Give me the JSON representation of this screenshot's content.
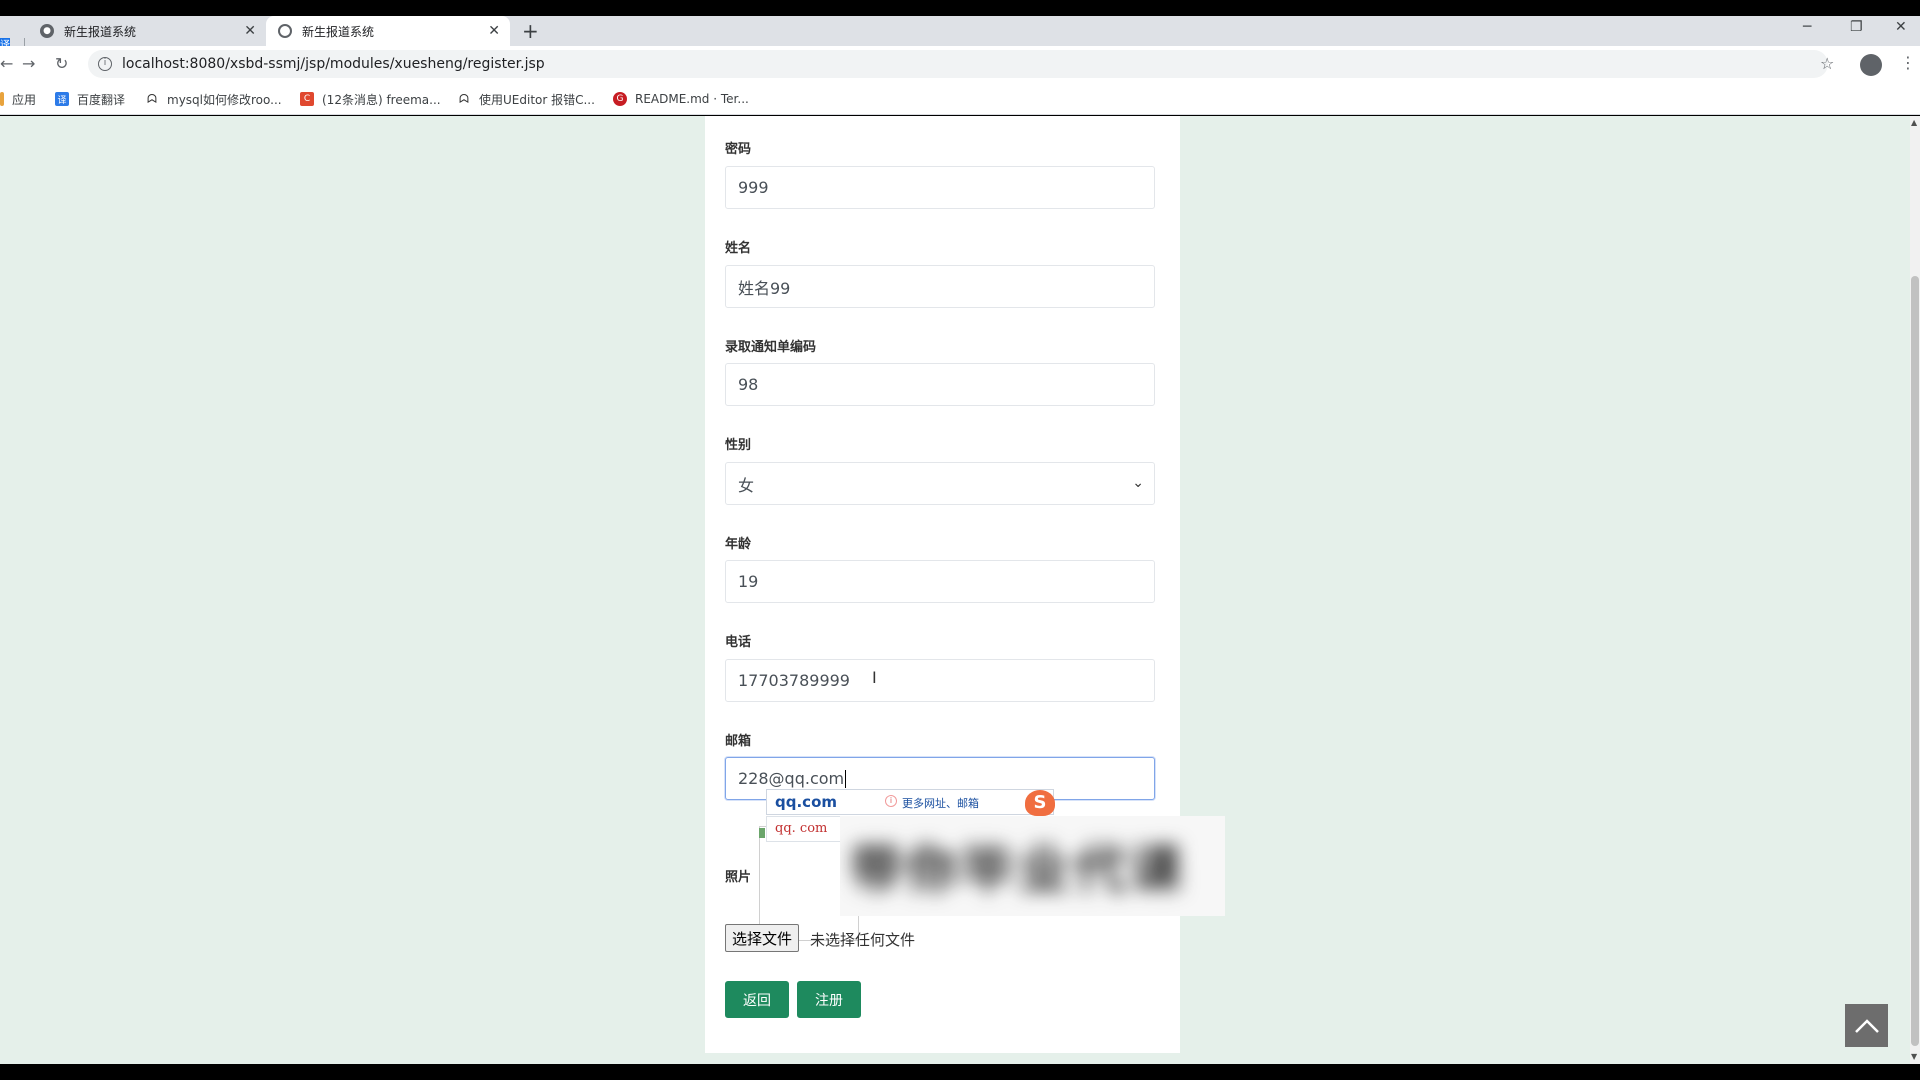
{
  "browser": {
    "tabs": [
      {
        "title": "新生报道系统",
        "active": false
      },
      {
        "title": "新生报道系统",
        "active": true
      }
    ],
    "url": "localhost:8080/xsbd-ssmj/jsp/modules/xuesheng/register.jsp",
    "bookmarks": [
      {
        "label": "应用",
        "icon": "apps-icon"
      },
      {
        "label": "百度翻译",
        "icon": "baidu-translate-icon"
      },
      {
        "label": "mysql如何修改roo...",
        "icon": "link-icon"
      },
      {
        "label": "(12条消息) freema...",
        "icon": "csdn-icon"
      },
      {
        "label": "使用UEditor 报错C...",
        "icon": "link-icon"
      },
      {
        "label": "README.md · Ter...",
        "icon": "gitee-icon"
      }
    ]
  },
  "form": {
    "password": {
      "label": "密码",
      "value": "999"
    },
    "name": {
      "label": "姓名",
      "value": "姓名99"
    },
    "admission_no": {
      "label": "录取通知单编码",
      "value": "98"
    },
    "gender": {
      "label": "性别",
      "value": "女"
    },
    "age": {
      "label": "年龄",
      "value": "19"
    },
    "phone": {
      "label": "电话",
      "value": "17703789999"
    },
    "email": {
      "label": "邮箱",
      "value": "228@qq.com"
    },
    "photo": {
      "label": "照片",
      "file_button": "选择文件",
      "file_status": "未选择任何文件"
    },
    "back_button": "返回",
    "register_button": "注册"
  },
  "ime_popup": {
    "composition": "qq.com",
    "hint": "更多网址、邮箱",
    "candidate": "qq. com",
    "logo": "S"
  },
  "blurred_overlay": {
    "text": "带你毕业代课"
  },
  "colors": {
    "page_bg": "#e5f0ea",
    "button_green": "#1e8a5e",
    "focus_border": "#80a5e8"
  }
}
